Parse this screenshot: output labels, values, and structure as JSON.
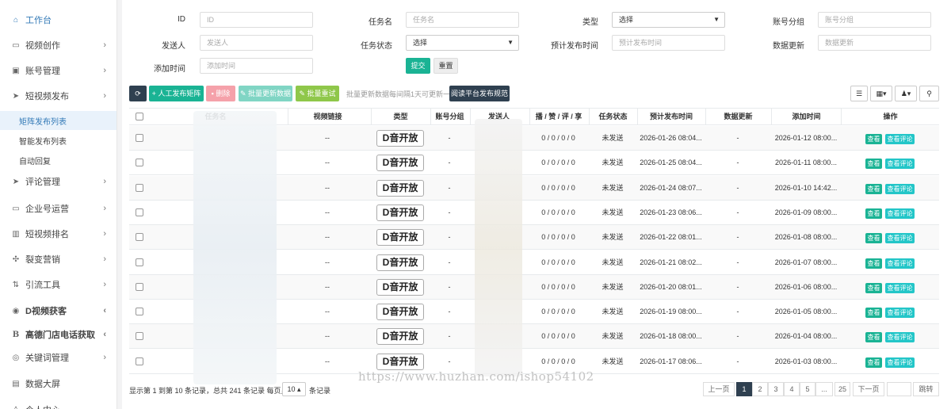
{
  "sidebar": {
    "items": [
      {
        "label": "工作台",
        "icon": "home-icon",
        "chevron": false,
        "active": true
      },
      {
        "label": "视频创作",
        "icon": "video-icon",
        "chevron": true
      },
      {
        "label": "账号管理",
        "icon": "account-icon",
        "chevron": true
      },
      {
        "label": "短视频发布",
        "icon": "send-icon",
        "chevron": true
      },
      {
        "label": "评论管理",
        "icon": "comment-icon",
        "chevron": true
      },
      {
        "label": "企业号运营",
        "icon": "enterprise-icon",
        "chevron": true
      },
      {
        "label": "短视频排名",
        "icon": "ranking-icon",
        "chevron": true
      },
      {
        "label": "裂变营销",
        "icon": "fission-icon",
        "chevron": true
      },
      {
        "label": "引流工具",
        "icon": "tool-icon",
        "chevron": true
      },
      {
        "label": "D视频获客",
        "icon": "eye-icon",
        "chevron": true
      },
      {
        "label": "高德门店电话获取",
        "icon": "b-icon",
        "chevron": true
      },
      {
        "label": "关键词管理",
        "icon": "keyword-icon",
        "chevron": true
      },
      {
        "label": "数据大屏",
        "icon": "screen-icon",
        "chevron": false
      },
      {
        "label": "个人中心",
        "icon": "user-icon",
        "chevron": false
      }
    ],
    "subitems": [
      {
        "label": "矩阵发布列表",
        "selected": true
      },
      {
        "label": "智能发布列表",
        "selected": false
      },
      {
        "label": "自动回复",
        "selected": false
      }
    ]
  },
  "filters": {
    "id": {
      "label": "ID",
      "placeholder": "ID"
    },
    "task_name": {
      "label": "任务名",
      "placeholder": "任务名"
    },
    "type": {
      "label": "类型",
      "value": "选择"
    },
    "account_group": {
      "label": "账号分组",
      "placeholder": "账号分组"
    },
    "sender": {
      "label": "发送人",
      "placeholder": "发送人"
    },
    "task_status": {
      "label": "任务状态",
      "value": "选择"
    },
    "plan_time": {
      "label": "预计发布时间",
      "placeholder": "预计发布时间"
    },
    "data_update": {
      "label": "数据更新",
      "placeholder": "数据更新"
    },
    "add_time": {
      "label": "添加时间",
      "placeholder": "添加时间"
    },
    "submit": "提交",
    "reset": "重置"
  },
  "toolbar": {
    "manual_publish": "人工发布矩阵",
    "delete": "删除",
    "batch_update": "批量更新数据",
    "batch_retry": "批量重试",
    "hint": "批量更新数据每间隔1天可更新一次",
    "read_rules": "阅读平台发布规范"
  },
  "table": {
    "headers": [
      "任务名",
      "视频链接",
      "类型",
      "账号分组",
      "发送人",
      "播 / 赞 / 评 / 享",
      "任务状态",
      "预计发布时间",
      "数据更新",
      "添加时间",
      "操作"
    ],
    "type_label": "D音开放",
    "view_label": "查看",
    "comment_label": "查看评论",
    "rows": [
      {
        "link": "--",
        "group": "-",
        "stats": "0 / 0 / 0 / 0",
        "status": "未发送",
        "plan": "2026-01-26 08:04...",
        "update": "-",
        "added": "2026-01-12 08:00..."
      },
      {
        "link": "--",
        "group": "-",
        "stats": "0 / 0 / 0 / 0",
        "status": "未发送",
        "plan": "2026-01-25 08:04...",
        "update": "-",
        "added": "2026-01-11 08:00..."
      },
      {
        "link": "--",
        "group": "-",
        "stats": "0 / 0 / 0 / 0",
        "status": "未发送",
        "plan": "2026-01-24 08:07...",
        "update": "-",
        "added": "2026-01-10 14:42..."
      },
      {
        "link": "--",
        "group": "-",
        "stats": "0 / 0 / 0 / 0",
        "status": "未发送",
        "plan": "2026-01-23 08:06...",
        "update": "-",
        "added": "2026-01-09 08:00..."
      },
      {
        "link": "--",
        "group": "-",
        "stats": "0 / 0 / 0 / 0",
        "status": "未发送",
        "plan": "2026-01-22 08:01...",
        "update": "-",
        "added": "2026-01-08 08:00..."
      },
      {
        "link": "--",
        "group": "-",
        "stats": "0 / 0 / 0 / 0",
        "status": "未发送",
        "plan": "2026-01-21 08:02...",
        "update": "-",
        "added": "2026-01-07 08:00..."
      },
      {
        "link": "--",
        "group": "-",
        "stats": "0 / 0 / 0 / 0",
        "status": "未发送",
        "plan": "2026-01-20 08:01...",
        "update": "-",
        "added": "2026-01-06 08:00..."
      },
      {
        "link": "--",
        "group": "-",
        "stats": "0 / 0 / 0 / 0",
        "status": "未发送",
        "plan": "2026-01-19 08:00...",
        "update": "-",
        "added": "2026-01-05 08:00..."
      },
      {
        "link": "--",
        "group": "-",
        "stats": "0 / 0 / 0 / 0",
        "status": "未发送",
        "plan": "2026-01-18 08:00...",
        "update": "-",
        "added": "2026-01-04 08:00..."
      },
      {
        "link": "--",
        "group": "-",
        "stats": "0 / 0 / 0 / 0",
        "status": "未发送",
        "plan": "2026-01-17 08:06...",
        "update": "-",
        "added": "2026-01-03 08:00..."
      }
    ]
  },
  "footer": {
    "summary_prefix": "显示第 1 到第 10 条记录，总共 241 条记录 每页显示",
    "page_size": "10",
    "summary_suffix": "条记录",
    "prev": "上一页",
    "pages": [
      "1",
      "2",
      "3",
      "4",
      "5",
      "...",
      "25"
    ],
    "current_page": "1",
    "next": "下一页",
    "jump": "跳转"
  },
  "watermark": "https://www.huzhan.com/ishop54102",
  "colors": {
    "accent": "#1ab394",
    "dark": "#2f4050",
    "link": "#337ab7",
    "cyan": "#23c6c8"
  }
}
